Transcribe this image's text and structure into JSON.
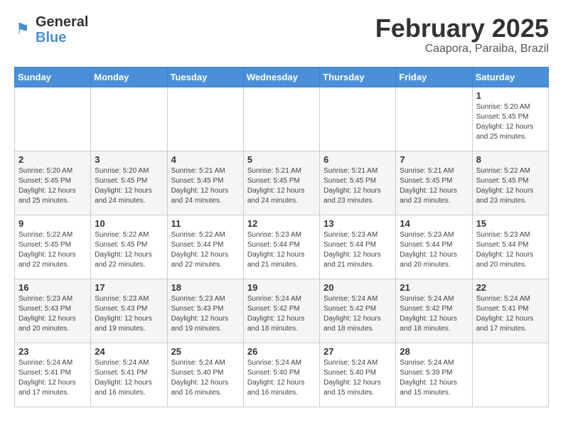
{
  "header": {
    "logo_general": "General",
    "logo_blue": "Blue",
    "month_year": "February 2025",
    "location": "Caapora, Paraiba, Brazil"
  },
  "weekdays": [
    "Sunday",
    "Monday",
    "Tuesday",
    "Wednesday",
    "Thursday",
    "Friday",
    "Saturday"
  ],
  "weeks": [
    [
      {
        "day": "",
        "info": ""
      },
      {
        "day": "",
        "info": ""
      },
      {
        "day": "",
        "info": ""
      },
      {
        "day": "",
        "info": ""
      },
      {
        "day": "",
        "info": ""
      },
      {
        "day": "",
        "info": ""
      },
      {
        "day": "1",
        "info": "Sunrise: 5:20 AM\nSunset: 5:45 PM\nDaylight: 12 hours\nand 25 minutes."
      }
    ],
    [
      {
        "day": "2",
        "info": "Sunrise: 5:20 AM\nSunset: 5:45 PM\nDaylight: 12 hours\nand 25 minutes."
      },
      {
        "day": "3",
        "info": "Sunrise: 5:20 AM\nSunset: 5:45 PM\nDaylight: 12 hours\nand 24 minutes."
      },
      {
        "day": "4",
        "info": "Sunrise: 5:21 AM\nSunset: 5:45 PM\nDaylight: 12 hours\nand 24 minutes."
      },
      {
        "day": "5",
        "info": "Sunrise: 5:21 AM\nSunset: 5:45 PM\nDaylight: 12 hours\nand 24 minutes."
      },
      {
        "day": "6",
        "info": "Sunrise: 5:21 AM\nSunset: 5:45 PM\nDaylight: 12 hours\nand 23 minutes."
      },
      {
        "day": "7",
        "info": "Sunrise: 5:21 AM\nSunset: 5:45 PM\nDaylight: 12 hours\nand 23 minutes."
      },
      {
        "day": "8",
        "info": "Sunrise: 5:22 AM\nSunset: 5:45 PM\nDaylight: 12 hours\nand 23 minutes."
      }
    ],
    [
      {
        "day": "9",
        "info": "Sunrise: 5:22 AM\nSunset: 5:45 PM\nDaylight: 12 hours\nand 22 minutes."
      },
      {
        "day": "10",
        "info": "Sunrise: 5:22 AM\nSunset: 5:45 PM\nDaylight: 12 hours\nand 22 minutes."
      },
      {
        "day": "11",
        "info": "Sunrise: 5:22 AM\nSunset: 5:44 PM\nDaylight: 12 hours\nand 22 minutes."
      },
      {
        "day": "12",
        "info": "Sunrise: 5:23 AM\nSunset: 5:44 PM\nDaylight: 12 hours\nand 21 minutes."
      },
      {
        "day": "13",
        "info": "Sunrise: 5:23 AM\nSunset: 5:44 PM\nDaylight: 12 hours\nand 21 minutes."
      },
      {
        "day": "14",
        "info": "Sunrise: 5:23 AM\nSunset: 5:44 PM\nDaylight: 12 hours\nand 20 minutes."
      },
      {
        "day": "15",
        "info": "Sunrise: 5:23 AM\nSunset: 5:44 PM\nDaylight: 12 hours\nand 20 minutes."
      }
    ],
    [
      {
        "day": "16",
        "info": "Sunrise: 5:23 AM\nSunset: 5:43 PM\nDaylight: 12 hours\nand 20 minutes."
      },
      {
        "day": "17",
        "info": "Sunrise: 5:23 AM\nSunset: 5:43 PM\nDaylight: 12 hours\nand 19 minutes."
      },
      {
        "day": "18",
        "info": "Sunrise: 5:23 AM\nSunset: 5:43 PM\nDaylight: 12 hours\nand 19 minutes."
      },
      {
        "day": "19",
        "info": "Sunrise: 5:24 AM\nSunset: 5:42 PM\nDaylight: 12 hours\nand 18 minutes."
      },
      {
        "day": "20",
        "info": "Sunrise: 5:24 AM\nSunset: 5:42 PM\nDaylight: 12 hours\nand 18 minutes."
      },
      {
        "day": "21",
        "info": "Sunrise: 5:24 AM\nSunset: 5:42 PM\nDaylight: 12 hours\nand 18 minutes."
      },
      {
        "day": "22",
        "info": "Sunrise: 5:24 AM\nSunset: 5:41 PM\nDaylight: 12 hours\nand 17 minutes."
      }
    ],
    [
      {
        "day": "23",
        "info": "Sunrise: 5:24 AM\nSunset: 5:41 PM\nDaylight: 12 hours\nand 17 minutes."
      },
      {
        "day": "24",
        "info": "Sunrise: 5:24 AM\nSunset: 5:41 PM\nDaylight: 12 hours\nand 16 minutes."
      },
      {
        "day": "25",
        "info": "Sunrise: 5:24 AM\nSunset: 5:40 PM\nDaylight: 12 hours\nand 16 minutes."
      },
      {
        "day": "26",
        "info": "Sunrise: 5:24 AM\nSunset: 5:40 PM\nDaylight: 12 hours\nand 16 minutes."
      },
      {
        "day": "27",
        "info": "Sunrise: 5:24 AM\nSunset: 5:40 PM\nDaylight: 12 hours\nand 15 minutes."
      },
      {
        "day": "28",
        "info": "Sunrise: 5:24 AM\nSunset: 5:39 PM\nDaylight: 12 hours\nand 15 minutes."
      },
      {
        "day": "",
        "info": ""
      }
    ]
  ]
}
